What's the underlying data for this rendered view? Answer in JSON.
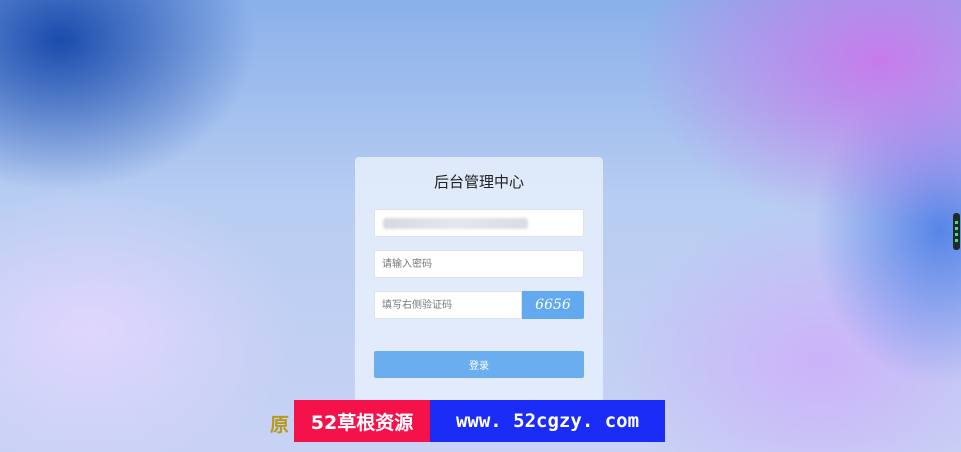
{
  "login": {
    "title": "后台管理中心",
    "password_placeholder": "请输入密码",
    "captcha_placeholder": "填写右侧验证码",
    "captcha_code": "6656",
    "login_button": "登录"
  },
  "watermark": {
    "left_fragment": "原",
    "badge_text": "52草根资源",
    "url_text": "www. 52cgzy. com"
  },
  "colors": {
    "accent": "#63a9ef",
    "watermark_red": "#f5124a",
    "watermark_blue": "#1a2cf5"
  }
}
